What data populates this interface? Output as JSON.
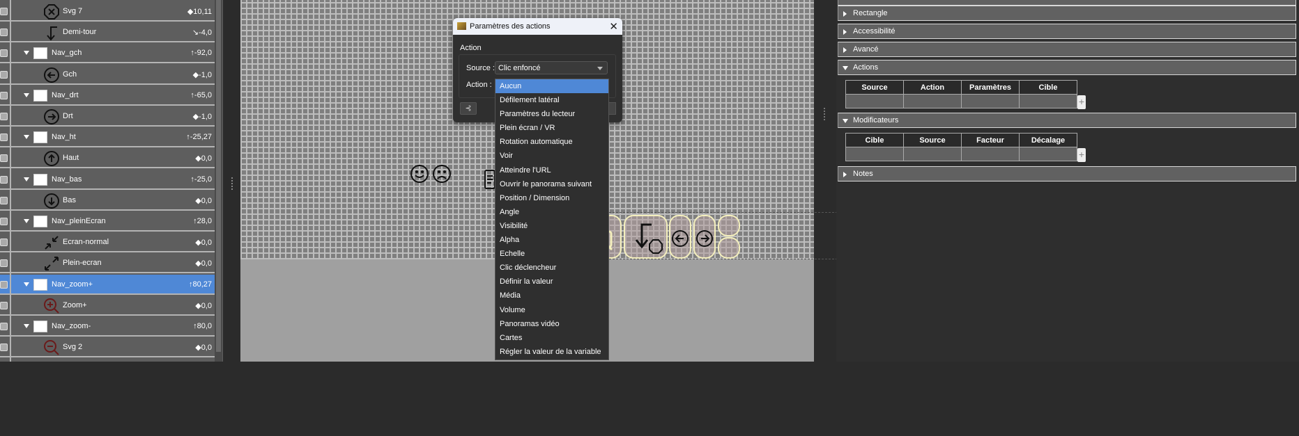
{
  "layers": [
    {
      "name": "Svg 7",
      "value": "◆10,11",
      "kind": "child",
      "icon": "close-octagon-icon"
    },
    {
      "name": "Demi-tour",
      "value": "↘-4,0",
      "kind": "child",
      "icon": "u-turn-arrow-icon"
    },
    {
      "name": "Nav_gch",
      "value": "↑-92,0",
      "kind": "group"
    },
    {
      "name": "Gch",
      "value": "◆-1,0",
      "kind": "child",
      "icon": "arrow-left-circle-icon"
    },
    {
      "name": "Nav_drt",
      "value": "↑-65,0",
      "kind": "group"
    },
    {
      "name": "Drt",
      "value": "◆-1,0",
      "kind": "child",
      "icon": "arrow-right-circle-icon"
    },
    {
      "name": "Nav_ht",
      "value": "↑-25,27",
      "kind": "group"
    },
    {
      "name": "Haut",
      "value": "◆0,0",
      "kind": "child",
      "icon": "arrow-up-circle-icon"
    },
    {
      "name": "Nav_bas",
      "value": "↑-25,0",
      "kind": "group"
    },
    {
      "name": "Bas",
      "value": "◆0,0",
      "kind": "child",
      "icon": "arrow-down-circle-icon"
    },
    {
      "name": "Nav_pleinEcran",
      "value": "↑28,0",
      "kind": "group"
    },
    {
      "name": "Ecran-normal",
      "value": "◆0,0",
      "kind": "child",
      "icon": "exit-fullscreen-icon"
    },
    {
      "name": "Plein-ecran",
      "value": "◆0,0",
      "kind": "child",
      "icon": "fullscreen-icon"
    },
    {
      "name": "Nav_zoom+",
      "value": "↑80,27",
      "kind": "group",
      "selected": true
    },
    {
      "name": "Zoom+",
      "value": "◆0,0",
      "kind": "child",
      "icon": "zoom-in-icon"
    },
    {
      "name": "Nav_zoom-",
      "value": "↑80,0",
      "kind": "group"
    },
    {
      "name": "Svg 2",
      "value": "◆0,0",
      "kind": "child",
      "icon": "zoom-out-icon"
    }
  ],
  "dialog": {
    "title": "Paramètres des actions",
    "group_label": "Action",
    "source_label": "Source :",
    "source_value": "Clic enfoncé",
    "action_label": "Action :"
  },
  "action_options": [
    "Aucun",
    "Défilement latéral",
    "Paramètres du lecteur",
    "Plein écran / VR",
    "Rotation automatique",
    "Voir",
    "Atteindre l'URL",
    "Ouvrir le panorama suivant",
    "Position / Dimension",
    "Angle",
    "Visibilité",
    "Alpha",
    "Echelle",
    "Clic déclencheur",
    "Définir la valeur",
    "Média",
    "Volume",
    "Panoramas vidéo",
    "Cartes",
    "Régler la valeur de la variable"
  ],
  "selected_option": "Aucun",
  "properties": {
    "sections": [
      {
        "label": "Rectangle",
        "open": false
      },
      {
        "label": "Accessibilité",
        "open": false
      },
      {
        "label": "Avancé",
        "open": false
      },
      {
        "label": "Actions",
        "open": true
      },
      {
        "label": "Modificateurs",
        "open": true
      },
      {
        "label": "Notes",
        "open": false
      }
    ],
    "actions_columns": [
      "Source",
      "Action",
      "Paramètres",
      "Cible"
    ],
    "modifiers_columns": [
      "Cible",
      "Source",
      "Facteur",
      "Décalage"
    ],
    "add_label": "+"
  },
  "colors": {
    "selection": "#4f88d6",
    "button_border": "#f4efbd",
    "accent_red": "#ff0000"
  }
}
